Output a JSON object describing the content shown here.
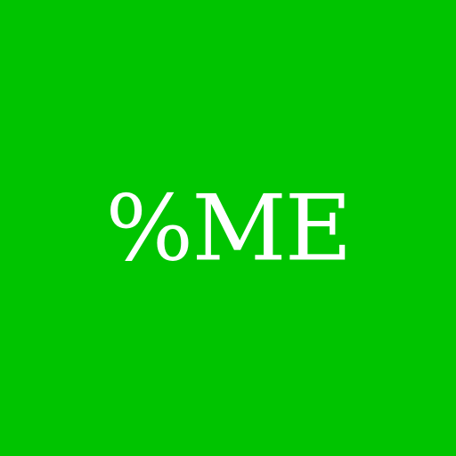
{
  "app_icon": {
    "background_color": "#00c400",
    "text_color": "#ffffff",
    "logo_text": "%ME"
  }
}
